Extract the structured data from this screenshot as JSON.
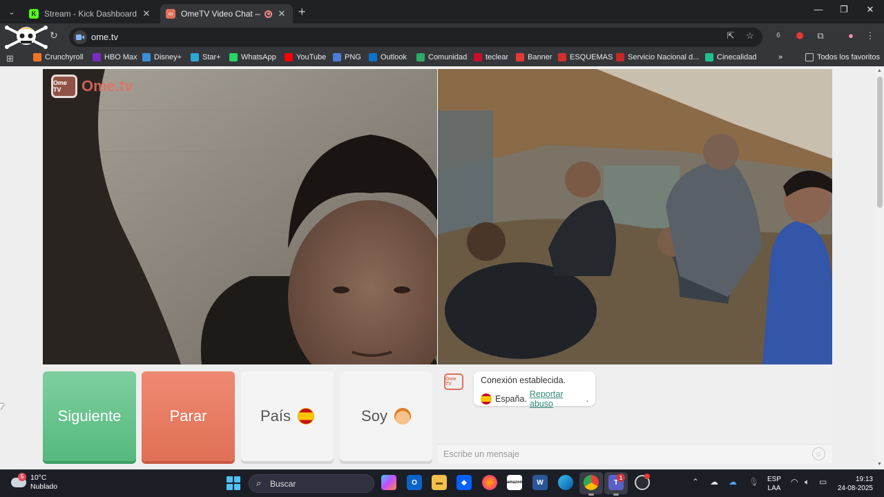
{
  "browser": {
    "tabs": [
      {
        "title": "Stream - Kick Dashboard",
        "active": false
      },
      {
        "title": "OmeTV Video Chat — Ome",
        "active": true
      }
    ],
    "url": "ome.tv",
    "bookmarks": [
      {
        "label": "Crunchyroll",
        "icon": "crunchyroll-icon",
        "color": "#f47521"
      },
      {
        "label": "HBO Max",
        "icon": "hbo-max-icon",
        "color": "#7b2cbf"
      },
      {
        "label": "Disney+",
        "icon": "disney-plus-icon",
        "color": "#3b8fd4"
      },
      {
        "label": "Star+",
        "icon": "star-plus-icon",
        "color": "#2ba8d6"
      },
      {
        "label": "WhatsApp",
        "icon": "whatsapp-icon",
        "color": "#25d366"
      },
      {
        "label": "YouTube",
        "icon": "youtube-icon",
        "color": "#ff0000"
      },
      {
        "label": "PNG",
        "icon": "png-icon",
        "color": "#4a7fd6"
      },
      {
        "label": "Outlook",
        "icon": "outlook-icon",
        "color": "#0a72c9"
      },
      {
        "label": "Comunidad",
        "icon": "comunidad-icon",
        "color": "#2eaa68"
      },
      {
        "label": "teclear",
        "icon": "teclear-icon",
        "color": "#c8102e"
      },
      {
        "label": "Banner",
        "icon": "banner-icon",
        "color": "#e53935"
      },
      {
        "label": "ESQUEMAS",
        "icon": "esquemas-icon",
        "color": "#d32f2f"
      },
      {
        "label": "Servicio Nacional d...",
        "icon": "servicio-nacional-icon",
        "color": "#c62828"
      },
      {
        "label": "Cinecalidad",
        "icon": "cinecalidad-icon",
        "color": "#1fbf8f"
      }
    ],
    "all_bookmarks": "Todos los favoritos",
    "extensions_badge": "6"
  },
  "page": {
    "brand": "Ome.tv",
    "brand_badge": "Ome TV",
    "buttons": {
      "next": "Siguiente",
      "stop": "Parar",
      "country": "País",
      "gender": "Soy"
    },
    "chat": {
      "system_line1": "Conexión establecida.",
      "country": "España.",
      "report": "Reportar abuso",
      "report_suffix": ".",
      "placeholder": "Escribe un mensaje"
    }
  },
  "taskbar": {
    "temperature": "10°C",
    "condition": "Nublado",
    "weather_badge": "5",
    "search": "Buscar",
    "teams_badge": "1",
    "lang1": "ESP",
    "lang2": "LAA",
    "time": "19:13",
    "date": "24-08-2025"
  },
  "colors": {
    "next": "#5fc085",
    "stop": "#e5785e",
    "link": "#2e8b7a",
    "chrome_dark": "#202124",
    "chrome_mid": "#35363a"
  }
}
